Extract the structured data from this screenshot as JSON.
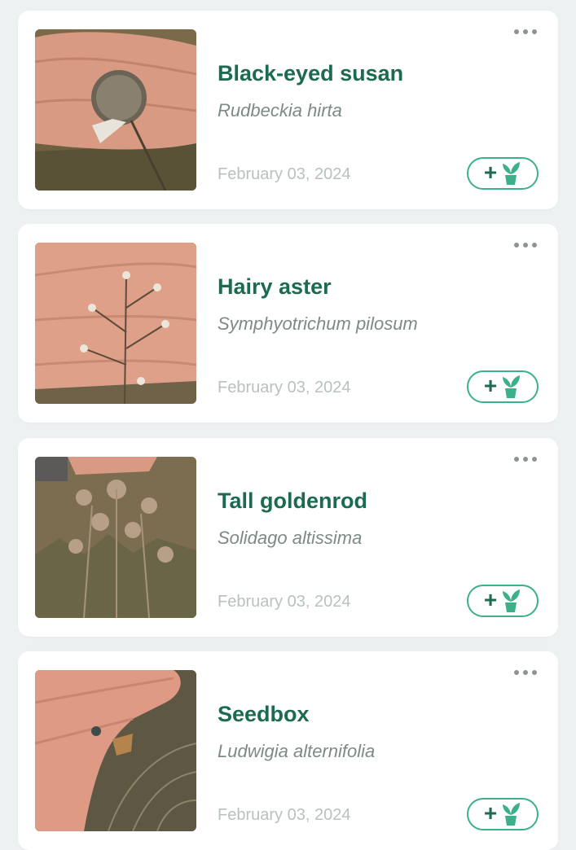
{
  "colors": {
    "background": "#eef1f1",
    "card": "#ffffff",
    "common_name": "#1d6a52",
    "accent": "#3bb08a"
  },
  "icons": {
    "more": "more-horizontal-icon",
    "add": "plus-icon",
    "plant": "potted-plant-icon"
  },
  "observations": [
    {
      "common_name": "Black-eyed susan",
      "scientific_name": "Rudbeckia hirta",
      "date": "February 03, 2024",
      "add_label": "+"
    },
    {
      "common_name": "Hairy aster",
      "scientific_name": "Symphyotrichum pilosum",
      "date": "February 03, 2024",
      "add_label": "+"
    },
    {
      "common_name": "Tall goldenrod",
      "scientific_name": "Solidago altissima",
      "date": "February 03, 2024",
      "add_label": "+"
    },
    {
      "common_name": "Seedbox",
      "scientific_name": "Ludwigia alternifolia",
      "date": "February 03, 2024",
      "add_label": "+"
    }
  ]
}
